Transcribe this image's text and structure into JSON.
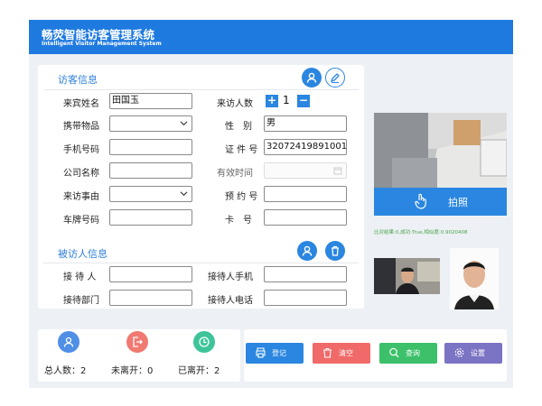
{
  "header": {
    "title": "畅荧智能访客管理系统",
    "subtitle": "Intelligent Visitor Management System"
  },
  "visitor": {
    "title": "访客信息",
    "name_label": "来宾姓名",
    "name_value": "田国玉",
    "count_label": "来访人数",
    "count_value": "1",
    "plus": "+",
    "minus": "−",
    "items_label": "携带物品",
    "gender_label": "性　别",
    "gender_value": "男",
    "phone_label": "手机号码",
    "id_label": "证 件 号",
    "id_value": "32072419891001",
    "company_label": "公司名称",
    "valid_label": "有效时间",
    "reason_label": "来访事由",
    "appt_label": "预 约 号",
    "plate_label": "车牌号码",
    "card_label": "卡　号"
  },
  "host": {
    "title": "被访人信息",
    "receiver_label": "接 待 人",
    "receiver_phone_label": "接待人手机",
    "dept_label": "接待部门",
    "receiver_tel_label": "接待人电话"
  },
  "camera": {
    "shoot_label": "拍照",
    "compare_text": "比对结果:0,成功:True,相似度:0.9020408"
  },
  "stats": {
    "total": "总人数：2",
    "not_left": "未离开：0",
    "left": "已离开：2"
  },
  "actions": {
    "register": "登记",
    "clear": "清空",
    "query": "查询",
    "settings": "设置"
  },
  "colors": {
    "primary": "#1f7ae0",
    "register": "#2a86e0",
    "clear": "#f06a6a",
    "query": "#3cc06a",
    "settings": "#7b73c4"
  }
}
